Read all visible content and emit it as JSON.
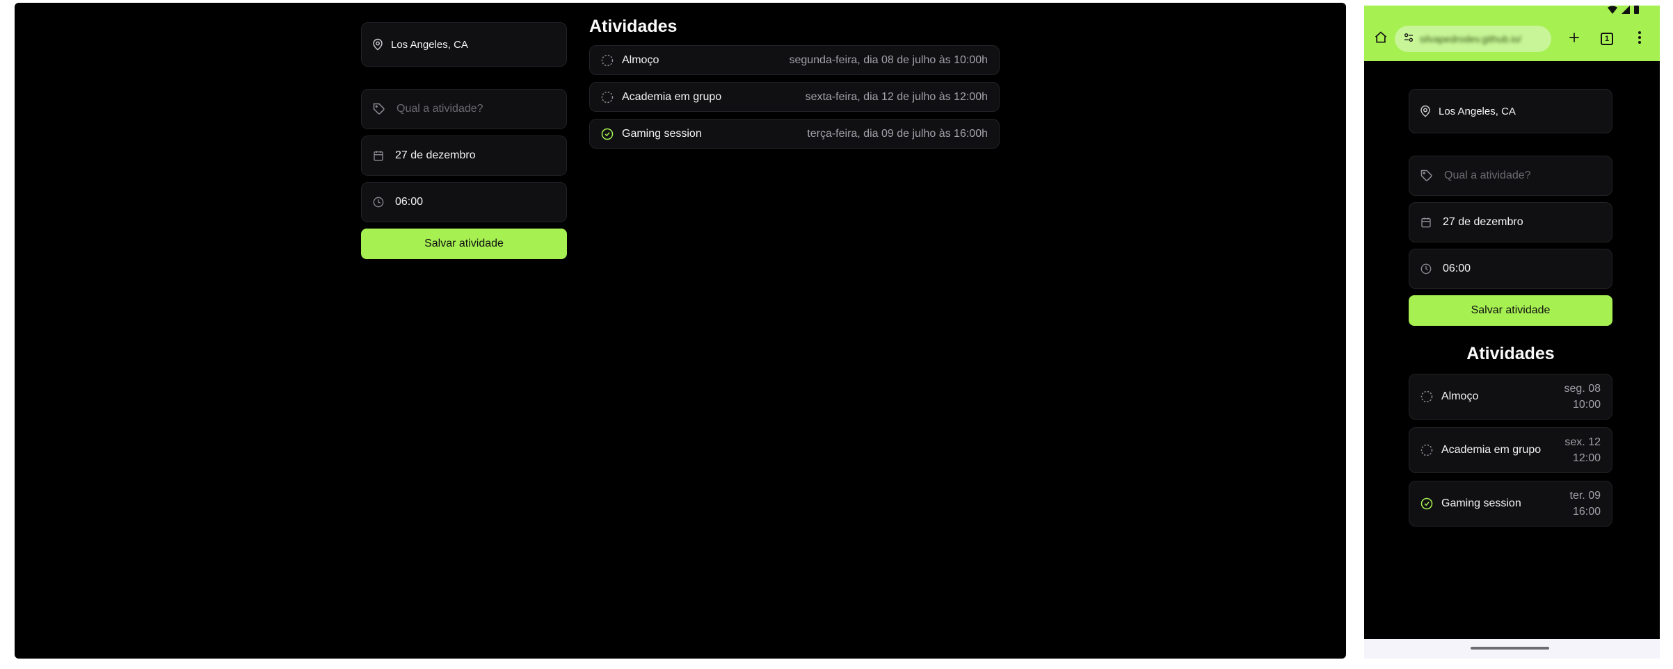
{
  "colors": {
    "accent": "#a6f052",
    "background": "#000000",
    "card": "#101012",
    "muted": "#a1a1aa"
  },
  "desktop": {
    "location": "Los Angeles, CA",
    "form": {
      "activity_placeholder": "Qual a atividade?",
      "date": "27 de dezembro",
      "time": "06:00",
      "save_label": "Salvar atividade"
    },
    "activities_title": "Atividades",
    "activities": [
      {
        "name": "Almoço",
        "date": "segunda-feira, dia 08 de julho às 10:00h",
        "done": false
      },
      {
        "name": "Academia em grupo",
        "date": "sexta-feira, dia 12 de julho às 12:00h",
        "done": false
      },
      {
        "name": "Gaming session",
        "date": "terça-feira, dia 09 de julho às 16:00h",
        "done": true
      }
    ]
  },
  "phone": {
    "url": "silvapedrodev.github.io/",
    "tab_count": "1",
    "location": "Los Angeles, CA",
    "form": {
      "activity_placeholder": "Qual a atividade?",
      "date": "27 de dezembro",
      "time": "06:00",
      "save_label": "Salvar atividade"
    },
    "activities_title": "Atividades",
    "activities": [
      {
        "name": "Almoço",
        "day": "seg. 08",
        "time": "10:00",
        "done": false
      },
      {
        "name": "Academia em grupo",
        "day": "sex. 12",
        "time": "12:00",
        "done": false
      },
      {
        "name": "Gaming session",
        "day": "ter. 09",
        "time": "16:00",
        "done": true
      }
    ]
  }
}
